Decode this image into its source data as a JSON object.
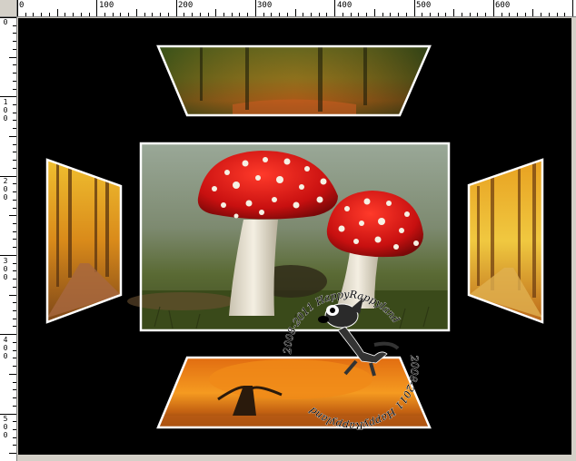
{
  "ruler": {
    "top_labels": [
      "0",
      "100",
      "200",
      "300",
      "400",
      "500",
      "600"
    ],
    "left_labels": [
      "0",
      "100",
      "200",
      "300",
      "400",
      "500"
    ]
  },
  "watermark": {
    "text_top": "2008-2011 HappyRappyland",
    "text_bottom": "2008-2011 HappyRappyland"
  },
  "colors": {
    "canvas": "#000000",
    "frame": "#ffffff",
    "workspace": "#d4d0c8"
  }
}
